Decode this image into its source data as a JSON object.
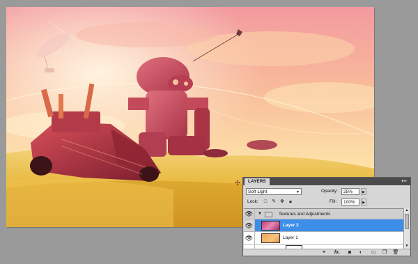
{
  "panel": {
    "tab_label": "LAYERS",
    "menu_icon": "panel-menu-icon",
    "blend_mode": "Soft Light",
    "opacity_label": "Opacity:",
    "opacity_value": "25%",
    "lock_label": "Lock:",
    "fill_label": "Fill:",
    "fill_value": "100%",
    "lock_icons": [
      "lock-transparency-icon",
      "lock-paint-icon",
      "lock-move-icon",
      "lock-all-icon"
    ],
    "layers": [
      {
        "name": "Textures and Adjustments",
        "type": "group",
        "visible": true
      },
      {
        "name": "Layer 2",
        "type": "layer",
        "visible": true,
        "selected": true
      },
      {
        "name": "Layer 1",
        "type": "layer",
        "visible": true,
        "selected": false
      }
    ],
    "bottom_icons": [
      "link-layers-icon",
      "fx-icon",
      "add-mask-icon",
      "adjustment-layer-icon",
      "new-group-icon",
      "new-layer-icon",
      "delete-layer-icon"
    ]
  },
  "colors": {
    "selection": "#3d8ee8",
    "sky_top": "#f59a95",
    "sky_bottom": "#fbe7a4",
    "grass": "#e9b93a"
  }
}
